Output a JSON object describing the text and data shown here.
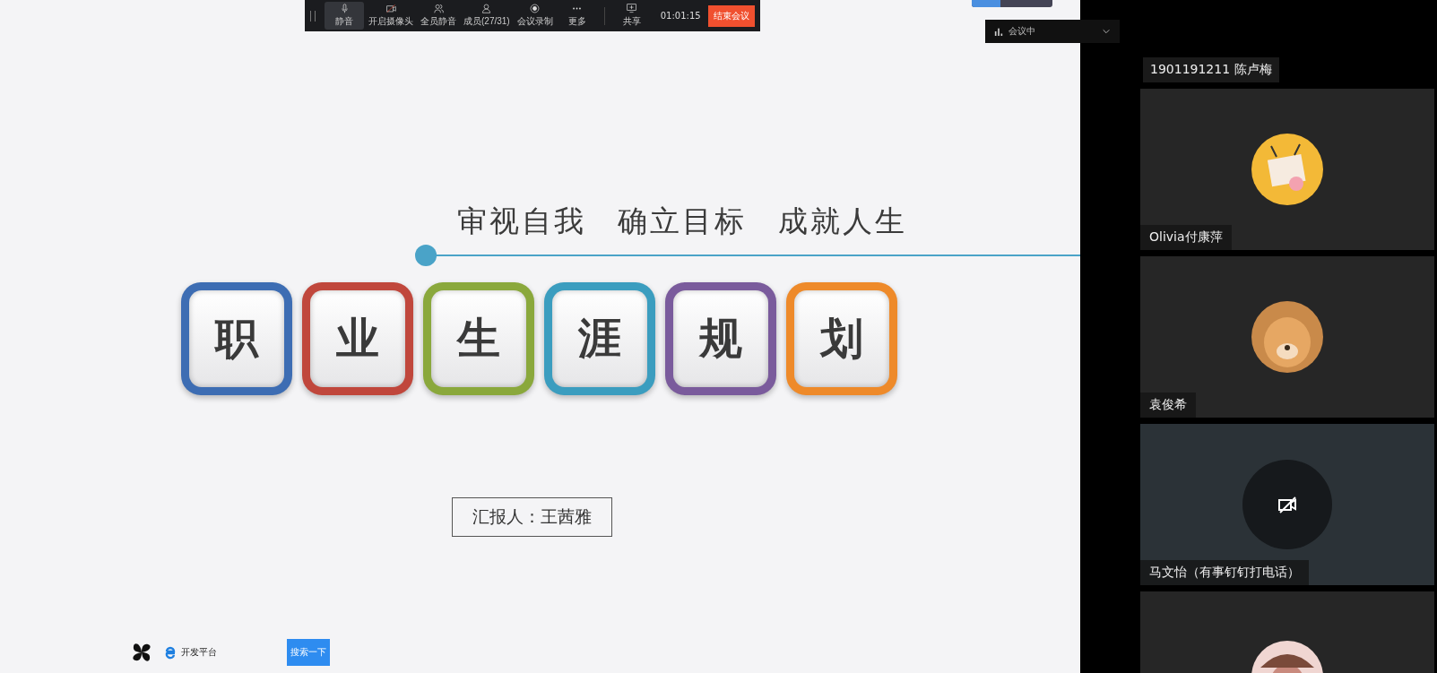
{
  "toolbar": {
    "items": [
      {
        "label": "静音",
        "selected": true
      },
      {
        "label": "开启摄像头",
        "selected": false
      },
      {
        "label": "全员静音",
        "selected": false
      },
      {
        "label": "成员(27/31)",
        "selected": false
      },
      {
        "label": "会议录制",
        "selected": false
      },
      {
        "label": "更多",
        "selected": false
      },
      {
        "label": "共享",
        "selected": false
      }
    ],
    "time": "01:01:15",
    "end_button": "结束会议"
  },
  "audio_meter": {
    "level": 0.35
  },
  "view_dropdown": {
    "label": "会议中"
  },
  "slide": {
    "subtitle": "审视自我  确立目标  成就人生",
    "characters": [
      {
        "text": "职",
        "color": "#3d6db3"
      },
      {
        "text": "业",
        "color": "#c0473c"
      },
      {
        "text": "生",
        "color": "#8aa83c"
      },
      {
        "text": "涯",
        "color": "#3b9dbf"
      },
      {
        "text": "规",
        "color": "#7a5b9c"
      },
      {
        "text": "划",
        "color": "#ee8a2a"
      }
    ],
    "reporter": "汇报人：王茜雅"
  },
  "taskbar": {
    "search_label": "开发平台",
    "search_button": "搜索一下"
  },
  "speaker": {
    "name": "1901191211 陈卢梅"
  },
  "participants": [
    {
      "kind": "cartoon",
      "name": "Olivia付康萍"
    },
    {
      "kind": "photo",
      "name": "袁俊希"
    },
    {
      "kind": "camera_off",
      "name": "马文怡（有事钉钉打电话）"
    },
    {
      "kind": "photo_pink"
    }
  ]
}
